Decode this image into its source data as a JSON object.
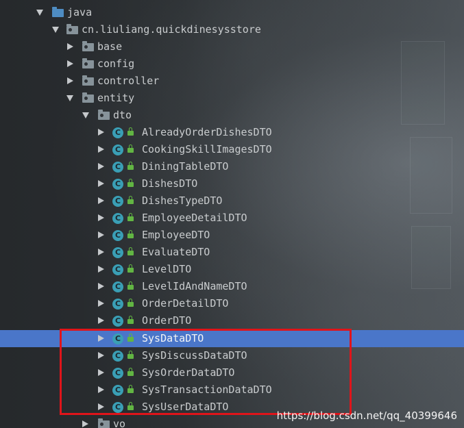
{
  "project_tree": {
    "nodes": [
      {
        "label": "java",
        "expanded": true,
        "icon": "source-folder-icon"
      },
      {
        "label": "cn.liuliang.quickdinesysstore",
        "expanded": true,
        "icon": "package-icon"
      },
      {
        "label": "base",
        "expanded": false,
        "icon": "package-icon"
      },
      {
        "label": "config",
        "expanded": false,
        "icon": "package-icon"
      },
      {
        "label": "controller",
        "expanded": false,
        "icon": "package-icon"
      },
      {
        "label": "entity",
        "expanded": true,
        "icon": "package-icon"
      },
      {
        "label": "dto",
        "expanded": true,
        "icon": "package-icon"
      },
      {
        "label": "AlreadyOrderDishesDTO",
        "icon": "class-icon"
      },
      {
        "label": "CookingSkillImagesDTO",
        "icon": "class-icon"
      },
      {
        "label": "DiningTableDTO",
        "icon": "class-icon"
      },
      {
        "label": "DishesDTO",
        "icon": "class-icon"
      },
      {
        "label": "DishesTypeDTO",
        "icon": "class-icon"
      },
      {
        "label": "EmployeeDetailDTO",
        "icon": "class-icon"
      },
      {
        "label": "EmployeeDTO",
        "icon": "class-icon"
      },
      {
        "label": "EvaluateDTO",
        "icon": "class-icon"
      },
      {
        "label": "LevelDTO",
        "icon": "class-icon"
      },
      {
        "label": "LevelIdAndNameDTO",
        "icon": "class-icon"
      },
      {
        "label": "OrderDetailDTO",
        "icon": "class-icon"
      },
      {
        "label": "OrderDTO",
        "icon": "class-icon"
      },
      {
        "label": "SysDataDTO",
        "icon": "class-icon",
        "selected": true
      },
      {
        "label": "SysDiscussDataDTO",
        "icon": "class-icon"
      },
      {
        "label": "SysOrderDataDTO",
        "icon": "class-icon"
      },
      {
        "label": "SysTransactionDataDTO",
        "icon": "class-icon"
      },
      {
        "label": "SysUserDataDTO",
        "icon": "class-icon"
      },
      {
        "label": "vo",
        "expanded": false,
        "icon": "package-icon"
      }
    ],
    "class_icon_letter": "C"
  },
  "colors": {
    "selection": "#4a76c9",
    "highlight_box": "#e0141a",
    "class_icon": "#3a9fb5",
    "access_icon": "#62b543",
    "source_folder": "#4e8cc2"
  },
  "watermark": "https://blog.csdn.net/qq_40399646"
}
